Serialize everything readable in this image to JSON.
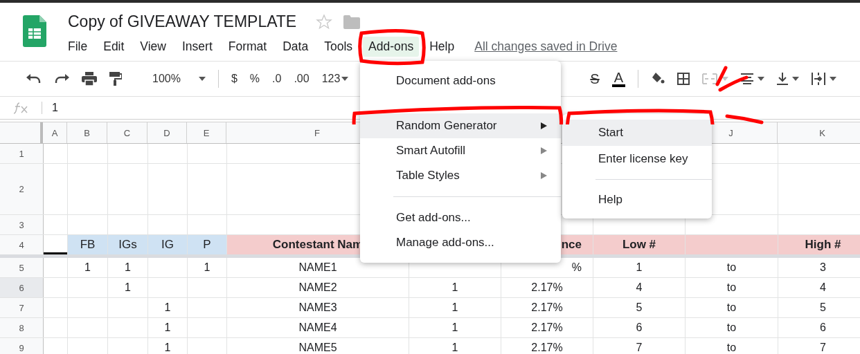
{
  "document": {
    "title": "Copy of GIVEAWAY TEMPLATE",
    "save_status": "All changes saved in Drive"
  },
  "menubar": [
    {
      "label": "File",
      "selected": false
    },
    {
      "label": "Edit",
      "selected": false
    },
    {
      "label": "View",
      "selected": false
    },
    {
      "label": "Insert",
      "selected": false
    },
    {
      "label": "Format",
      "selected": false
    },
    {
      "label": "Data",
      "selected": false
    },
    {
      "label": "Tools",
      "selected": false
    },
    {
      "label": "Add-ons",
      "selected": true
    },
    {
      "label": "Help",
      "selected": false
    }
  ],
  "toolbar": {
    "zoom": "100%",
    "currency": "$",
    "percent": "%",
    "decrease_decimals": ".0",
    "increase_decimals": ".00",
    "number_format": "123",
    "strikethrough": "S",
    "text_color": "A"
  },
  "formula_bar": {
    "value": "1"
  },
  "columns": [
    "A",
    "B",
    "C",
    "D",
    "E",
    "F",
    null,
    null,
    null,
    "J",
    "K"
  ],
  "rows": [
    {
      "number": "1",
      "selected": false,
      "tall": false,
      "cells": [
        null,
        null,
        null,
        null,
        null,
        null,
        null,
        null,
        null,
        null,
        null
      ]
    },
    {
      "number": "2",
      "selected": false,
      "tall": true,
      "cells": [
        null,
        null,
        null,
        null,
        null,
        null,
        null,
        null,
        null,
        null,
        null
      ]
    },
    {
      "number": "3",
      "selected": false,
      "tall": false,
      "cells": [
        null,
        null,
        null,
        null,
        null,
        null,
        null,
        null,
        null,
        null,
        null
      ]
    },
    {
      "number": "4",
      "selected": false,
      "tall": false,
      "cells": [
        null,
        {
          "text": "FB",
          "color": "#cfe2f3",
          "bold": false
        },
        {
          "text": "IGs",
          "color": "#cfe2f3",
          "bold": false
        },
        {
          "text": "IG",
          "color": "#cfe2f3",
          "bold": false
        },
        {
          "text": "P",
          "color": "#cfe2f3",
          "bold": false
        },
        {
          "text": "Contestant Nam",
          "color": "#f4cccc",
          "bold": true
        },
        null,
        {
          "text": "nce",
          "color": "#f4cccc",
          "bold": true,
          "partly_covered": true
        },
        {
          "text": "Low #",
          "color": "#f4cccc",
          "bold": true
        },
        {
          "text": null,
          "color": "#f4cccc",
          "bold": true
        },
        {
          "text": "High #",
          "color": "#f4cccc",
          "bold": true
        }
      ]
    },
    {
      "number": "5",
      "selected": false,
      "tall": false,
      "cells": [
        null,
        "1",
        "1",
        null,
        "1",
        "NAME1",
        null,
        {
          "text": "%",
          "partly_covered": true
        },
        "1",
        "to",
        "3"
      ]
    },
    {
      "number": "6",
      "selected": true,
      "tall": false,
      "cells": [
        null,
        null,
        "1",
        null,
        null,
        "NAME2",
        "1",
        "2.17%",
        "4",
        "to",
        "4"
      ]
    },
    {
      "number": "7",
      "selected": false,
      "tall": false,
      "cells": [
        null,
        null,
        null,
        "1",
        null,
        "NAME3",
        "1",
        "2.17%",
        "5",
        "to",
        "5"
      ]
    },
    {
      "number": "8",
      "selected": false,
      "tall": false,
      "cells": [
        null,
        null,
        null,
        "1",
        null,
        "NAME4",
        "1",
        "2.17%",
        "6",
        "to",
        "6"
      ]
    },
    {
      "number": "9",
      "selected": false,
      "tall": false,
      "cells": [
        null,
        null,
        null,
        "1",
        null,
        "NAME5",
        "1",
        "2.17%",
        "7",
        "to",
        "7"
      ]
    }
  ],
  "addons_menu": [
    {
      "kind": "item",
      "label": "Document add-ons",
      "selected": false,
      "submenu": false
    },
    {
      "kind": "gap"
    },
    {
      "kind": "item",
      "label": "Random Generator",
      "selected": true,
      "submenu": true
    },
    {
      "kind": "item",
      "label": "Smart Autofill",
      "selected": false,
      "submenu": true
    },
    {
      "kind": "item",
      "label": "Table Styles",
      "selected": false,
      "submenu": true
    },
    {
      "kind": "divider"
    },
    {
      "kind": "item",
      "label": "Get add-ons...",
      "selected": false,
      "submenu": false
    },
    {
      "kind": "item",
      "label": "Manage add-ons...",
      "selected": false,
      "submenu": false
    }
  ],
  "submenu": [
    {
      "kind": "item",
      "label": "Start",
      "selected": true
    },
    {
      "kind": "item",
      "label": "Enter license key",
      "selected": false
    },
    {
      "kind": "divider"
    },
    {
      "kind": "item",
      "label": "Help",
      "selected": false
    }
  ]
}
